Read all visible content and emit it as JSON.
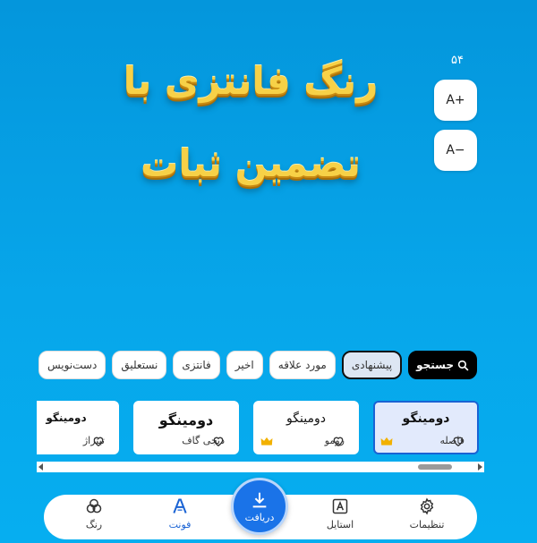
{
  "preview": {
    "text": "رنگ فانتزی با تضمین ثبات",
    "text_color": "#f7d147"
  },
  "size_control": {
    "value": "۵۴",
    "increase_label": "A+",
    "decrease_label": "A−"
  },
  "categories": {
    "search_label": "جستجو",
    "search_icon": "search-icon",
    "chips": [
      "پیشنهادی",
      "مورد علاقه",
      "اخیر",
      "فانتزی",
      "نستعلیق",
      "دست‌نویس"
    ],
    "active_chip": "پیشنهادی"
  },
  "fonts": [
    {
      "sample": "دومینگو",
      "name": "فاصله",
      "premium": true,
      "selected": true
    },
    {
      "sample": "دومینگو",
      "name": "رومو",
      "premium": true,
      "selected": false
    },
    {
      "sample": "دومینگو",
      "name": "دیجی گاف",
      "premium": false,
      "selected": false
    },
    {
      "sample": "دومینگو",
      "name": "تیتراژ",
      "premium": false,
      "selected": false
    }
  ],
  "nav": {
    "settings_label": "تنظیمات",
    "style_label": "استایل",
    "download_label": "دریافت",
    "font_label": "فونت",
    "color_label": "رنگ",
    "active": "font"
  },
  "colors": {
    "accent": "#1a73e8",
    "selected_card_border": "#1a63d4",
    "crown": "#f2b100",
    "background": "#0496dc"
  }
}
